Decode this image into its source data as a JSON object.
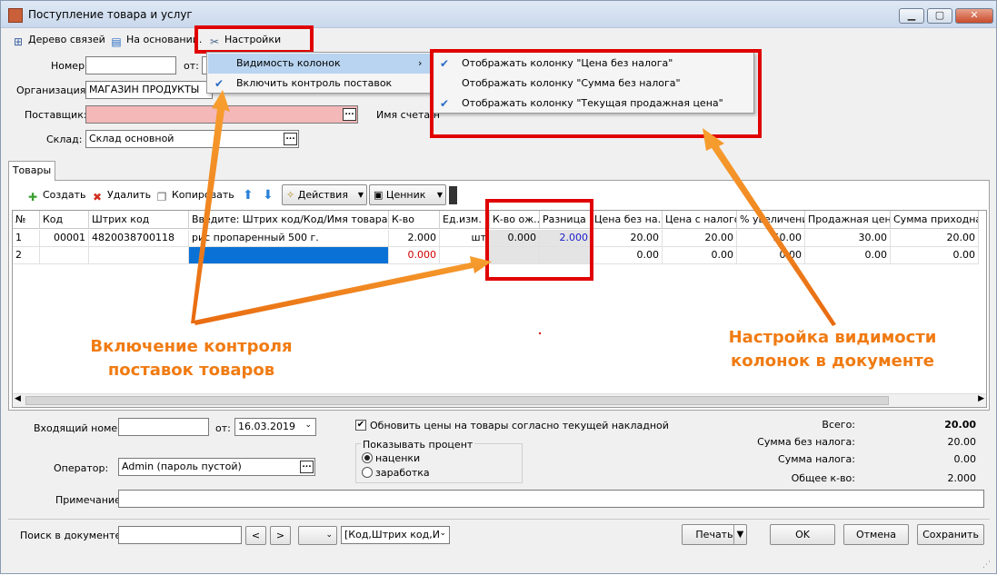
{
  "window": {
    "title": "Поступление товара и услуг",
    "min": "▁",
    "max": "▢",
    "close": "✕"
  },
  "toolbar": {
    "tree_label": "Дерево связей",
    "basis_label": "На основании.",
    "settings_label": "Настройки"
  },
  "header": {
    "number_label": "Номер:",
    "number_value": "",
    "from_label": "от:",
    "org_label": "Организация:",
    "org_value": "МАГАЗИН ПРОДУКТЫ",
    "supplier_label": "Поставщик:",
    "supplier_value": "",
    "invoice_label": "Имя счета/н",
    "warehouse_label": "Склад:",
    "warehouse_value": "Склад основной"
  },
  "settings_menu": {
    "items": [
      {
        "label": "Видимость колонок",
        "checked": false,
        "submenu_arrow": "›"
      },
      {
        "label": "Включить контроль поставок",
        "checked": true
      }
    ]
  },
  "submenu": {
    "items": [
      {
        "label": "Отображать колонку \"Цена без налога\"",
        "checked": true
      },
      {
        "label": "Отображать колонку \"Сумма без налога\"",
        "checked": false
      },
      {
        "label": "Отображать колонку \"Текущая продажная цена\"",
        "checked": true
      }
    ],
    "checkmark": "✔"
  },
  "tabs": {
    "goods": "Товары"
  },
  "grid_toolbar": {
    "create": "Создать",
    "delete": "Удалить",
    "copy": "Копировать",
    "actions": "Действия",
    "price_tag": "Ценник"
  },
  "grid": {
    "columns": [
      "№",
      "Код",
      "Штрих код",
      "Введите: Штрих код/Код/Имя товара",
      "К-во",
      "Ед.изм.",
      "К-во ож...",
      "Разница",
      "Цена без на...",
      "Цена с налогом",
      "% увеличения",
      "Продажная цена",
      "Сумма приходная"
    ],
    "rows": [
      [
        "1",
        "00001",
        "4820038700118",
        "рис пропаренный 500 г.",
        "2.000",
        "шт",
        "0.000",
        "2.000",
        "20.00",
        "20.00",
        "50.00",
        "30.00",
        "20.00"
      ],
      [
        "2",
        "",
        "",
        "",
        "0.000",
        "",
        "",
        "",
        "0.00",
        "0.00",
        "0.00",
        "0.00",
        "0.00"
      ]
    ]
  },
  "footer": {
    "incoming_label": "Входящий номер:",
    "incoming_value": "",
    "from_label": "от:",
    "date_value": "16.03.2019",
    "update_prices_label": "Обновить цены на товары согласно текущей накладной",
    "percent_group": "Показывать процент",
    "markup_label": "наценки",
    "profit_label": "заработка",
    "operator_label": "Оператор:",
    "operator_value": "Admin (пароль пустой)",
    "note_label": "Примечание:",
    "search_label": "Поиск в документе:",
    "search_hint": "[Код,Штрих код,И",
    "prev": "<",
    "next": ">",
    "totals": [
      {
        "label": "Всего:",
        "value": "20.00"
      },
      {
        "label": "Сумма без налога:",
        "value": "20.00"
      },
      {
        "label": "Сумма налога:",
        "value": "0.00"
      },
      {
        "label": "Общее к-во:",
        "value": "2.000"
      }
    ],
    "print": "Печать",
    "ok": "OK",
    "cancel": "Отмена",
    "save": "Сохранить"
  },
  "annotations": {
    "left": "Включение контроля\nпоставок товаров",
    "right": "Настройка видимости\nколонок в документе"
  },
  "colors": {
    "highlight_red": "#e00000",
    "annotation_orange": "#f07b12",
    "selection_blue": "#0a72d6"
  }
}
